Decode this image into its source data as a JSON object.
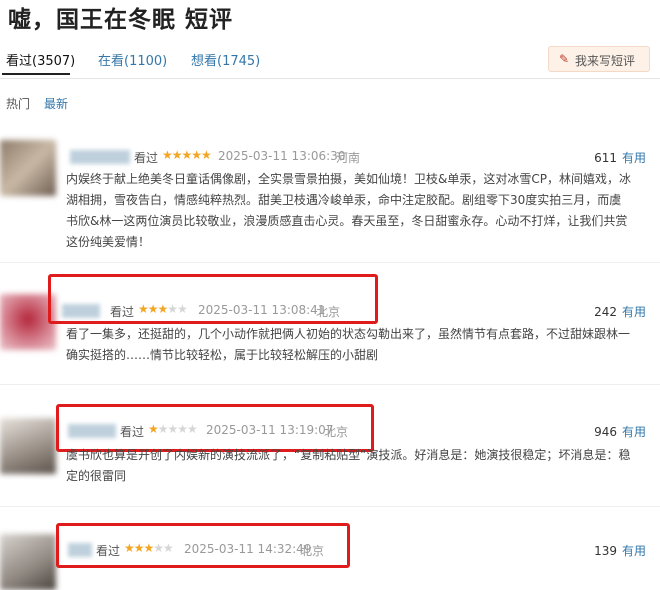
{
  "page": {
    "title": "嘘，国王在冬眠 短评"
  },
  "tabs": [
    {
      "label": "看过(3507)"
    },
    {
      "label": "在看(1100)"
    },
    {
      "label": "想看(1745)"
    }
  ],
  "write_button": {
    "label": "我来写短评",
    "icon": "pencil-icon"
  },
  "sort": {
    "hot": "热门",
    "latest": "最新"
  },
  "colors": {
    "accent": "#3377aa",
    "star": "#f4a623",
    "highlight": "#e01b1b"
  },
  "reviews": [
    {
      "status": "看过",
      "rating": 5,
      "time": "2025-03-11 13:06:30",
      "location": "河南",
      "votes": "611",
      "useful_label": "有用",
      "lines": [
        "内娱终于献上绝美冬日童话偶像剧，全实景雪景拍摄，美如仙境！卫枝&单汞，这对冰雪CP，林间嬉戏，冰",
        "湖相拥，雪夜告白，情感纯粹热烈。甜美卫枝遇冷峻单汞，命中注定胶配。剧组零下30度实拍三月，而虞",
        "书欣&林一这两位演员比较敬业，浪漫质感直击心灵。春天虽至，冬日甜蜜永存。心动不打烊，让我们共赏",
        "这份纯美爱情！"
      ]
    },
    {
      "status": "看过",
      "rating": 3,
      "time": "2025-03-11 13:08:41",
      "location": "北京",
      "votes": "242",
      "useful_label": "有用",
      "lines": [
        "看了一集多，还挺甜的，几个小动作就把俩人初始的状态勾勒出来了，虽然情节有点套路，不过甜妹跟林一",
        "确实挺搭的……情节比较轻松，属于比较轻松解压的小甜剧"
      ]
    },
    {
      "status": "看过",
      "rating": 1,
      "time": "2025-03-11 13:19:07",
      "location": "北京",
      "votes": "946",
      "useful_label": "有用",
      "lines": [
        "虞书欣也算是开创了内娱新的演技流派了，“复制粘贴型”演技派。好消息是：她演技很稳定；坏消息是：稳",
        "定的很雷同"
      ]
    },
    {
      "status": "看过",
      "rating": 3,
      "time": "2025-03-11 14:32:49",
      "location": "北京",
      "votes": "139",
      "useful_label": "有用",
      "lines": []
    }
  ]
}
